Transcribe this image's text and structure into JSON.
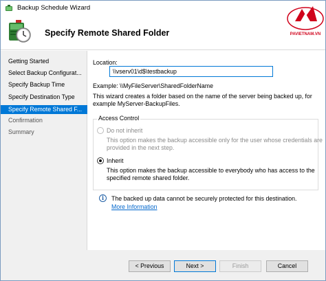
{
  "window": {
    "title": "Backup Schedule Wizard"
  },
  "header": {
    "heading": "Specify Remote Shared Folder"
  },
  "logo": {
    "text": "PAVIETNAM.VN"
  },
  "sidebar": {
    "items": [
      {
        "label": "Getting Started",
        "state": "done"
      },
      {
        "label": "Select Backup Configurat...",
        "state": "done"
      },
      {
        "label": "Specify Backup Time",
        "state": "done"
      },
      {
        "label": "Specify Destination Type",
        "state": "done"
      },
      {
        "label": "Specify Remote Shared F...",
        "state": "active"
      },
      {
        "label": "Confirmation",
        "state": "pending"
      },
      {
        "label": "Summary",
        "state": "pending"
      }
    ]
  },
  "form": {
    "location_label": "Location:",
    "location_value": "\\\\vserv01\\d$\\testbackup",
    "example_text": "Example: \\\\MyFileServer\\SharedFolderName",
    "wizard_desc_line1": "This wizard creates a folder based on the name of the server being backed up, for",
    "wizard_desc_line2": "example MyServer-BackupFiles."
  },
  "access_control": {
    "title": "Access Control",
    "do_not_inherit": {
      "label": "Do not inherit",
      "desc_line1": "This option makes the backup accessible only for the user whose credentials are",
      "desc_line2": "provided in the next step."
    },
    "inherit": {
      "label": "Inherit",
      "desc_line1": "This option makes the backup accessible to everybody who has access to the",
      "desc_line2": "specified remote shared folder."
    },
    "selected": "inherit"
  },
  "info": {
    "icon": "info-icon",
    "message": "The backed up data cannot be securely protected for this destination.",
    "link": "More Information"
  },
  "footer": {
    "previous_label": "< Previous",
    "next_label": "Next >",
    "finish_label": "Finish",
    "cancel_label": "Cancel"
  },
  "colors": {
    "accent": "#0078d7",
    "sidebar_bg": "#f0f0f0",
    "logo_red": "#d0021b",
    "link": "#0066cc"
  }
}
